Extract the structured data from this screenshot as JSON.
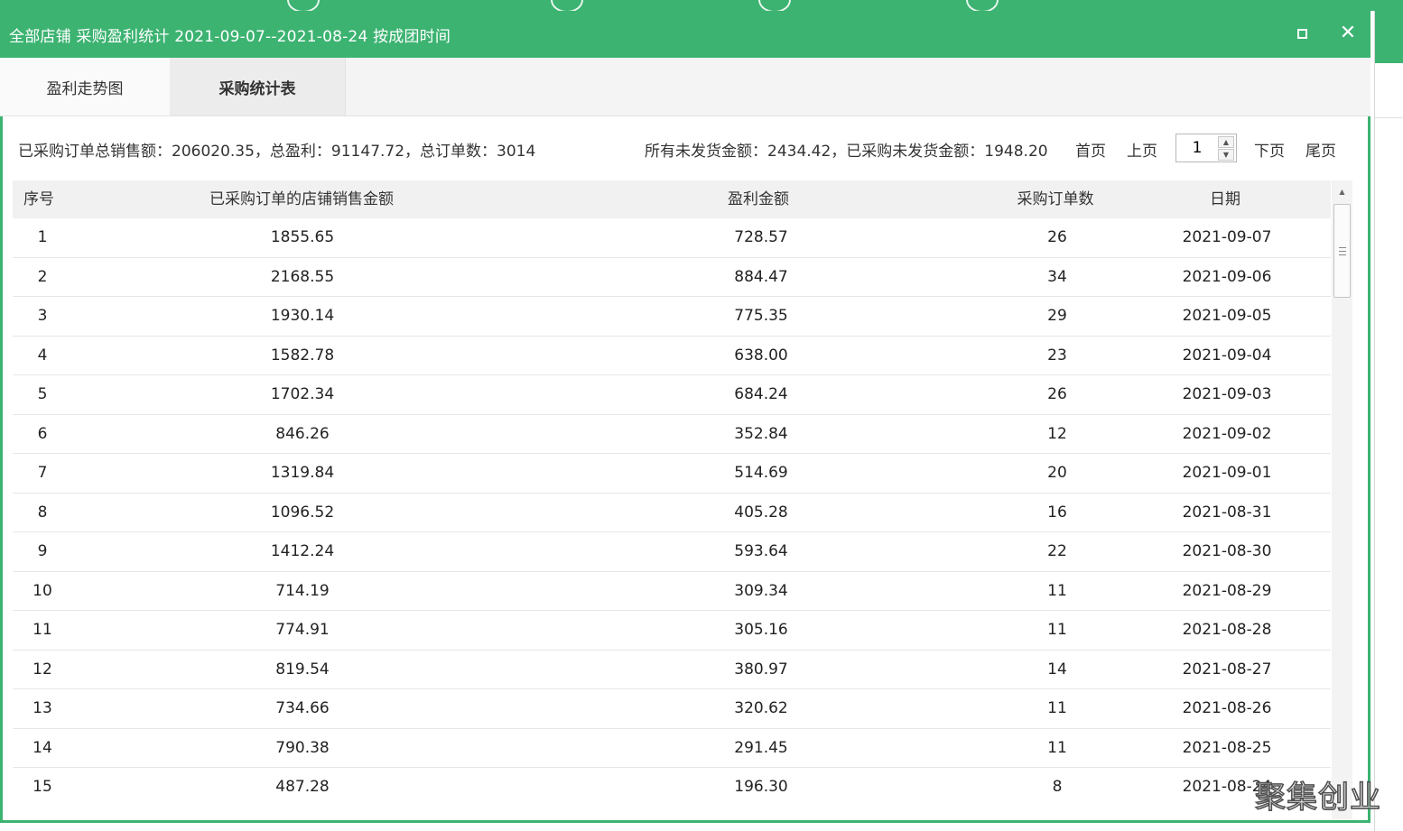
{
  "window": {
    "title": "全部店铺 采购盈利统计 2021-09-07--2021-08-24 按成团时间"
  },
  "tabs": [
    {
      "label": "盈利走势图"
    },
    {
      "label": "采购统计表"
    }
  ],
  "summary": {
    "left": "已采购订单总销售额：206020.35，总盈利：91147.72，总订单数：3014",
    "right": "所有未发货金额：2434.42，已采购未发货金额：1948.20"
  },
  "pagination": {
    "first": "首页",
    "prev": "上页",
    "page": "1",
    "next": "下页",
    "last": "尾页"
  },
  "table": {
    "columns": [
      "序号",
      "已采购订单的店铺销售金额",
      "盈利金额",
      "采购订单数",
      "日期"
    ],
    "rows": [
      [
        "1",
        "1855.65",
        "728.57",
        "26",
        "2021-09-07"
      ],
      [
        "2",
        "2168.55",
        "884.47",
        "34",
        "2021-09-06"
      ],
      [
        "3",
        "1930.14",
        "775.35",
        "29",
        "2021-09-05"
      ],
      [
        "4",
        "1582.78",
        "638.00",
        "23",
        "2021-09-04"
      ],
      [
        "5",
        "1702.34",
        "684.24",
        "26",
        "2021-09-03"
      ],
      [
        "6",
        "846.26",
        "352.84",
        "12",
        "2021-09-02"
      ],
      [
        "7",
        "1319.84",
        "514.69",
        "20",
        "2021-09-01"
      ],
      [
        "8",
        "1096.52",
        "405.28",
        "16",
        "2021-08-31"
      ],
      [
        "9",
        "1412.24",
        "593.64",
        "22",
        "2021-08-30"
      ],
      [
        "10",
        "714.19",
        "309.34",
        "11",
        "2021-08-29"
      ],
      [
        "11",
        "774.91",
        "305.16",
        "11",
        "2021-08-28"
      ],
      [
        "12",
        "819.54",
        "380.97",
        "14",
        "2021-08-27"
      ],
      [
        "13",
        "734.66",
        "320.62",
        "11",
        "2021-08-26"
      ],
      [
        "14",
        "790.38",
        "291.45",
        "11",
        "2021-08-25"
      ],
      [
        "15",
        "487.28",
        "196.30",
        "8",
        "2021-08-24"
      ]
    ]
  },
  "watermark": "聚集创业",
  "icons": {
    "maximize": "maximize-icon",
    "close": "close-icon",
    "scroll_up": "chevron-up-icon",
    "spin_up": "caret-up-icon",
    "spin_down": "caret-down-icon"
  },
  "colors": {
    "accent": "#3cb371",
    "header_bg": "#f1f1f1"
  }
}
